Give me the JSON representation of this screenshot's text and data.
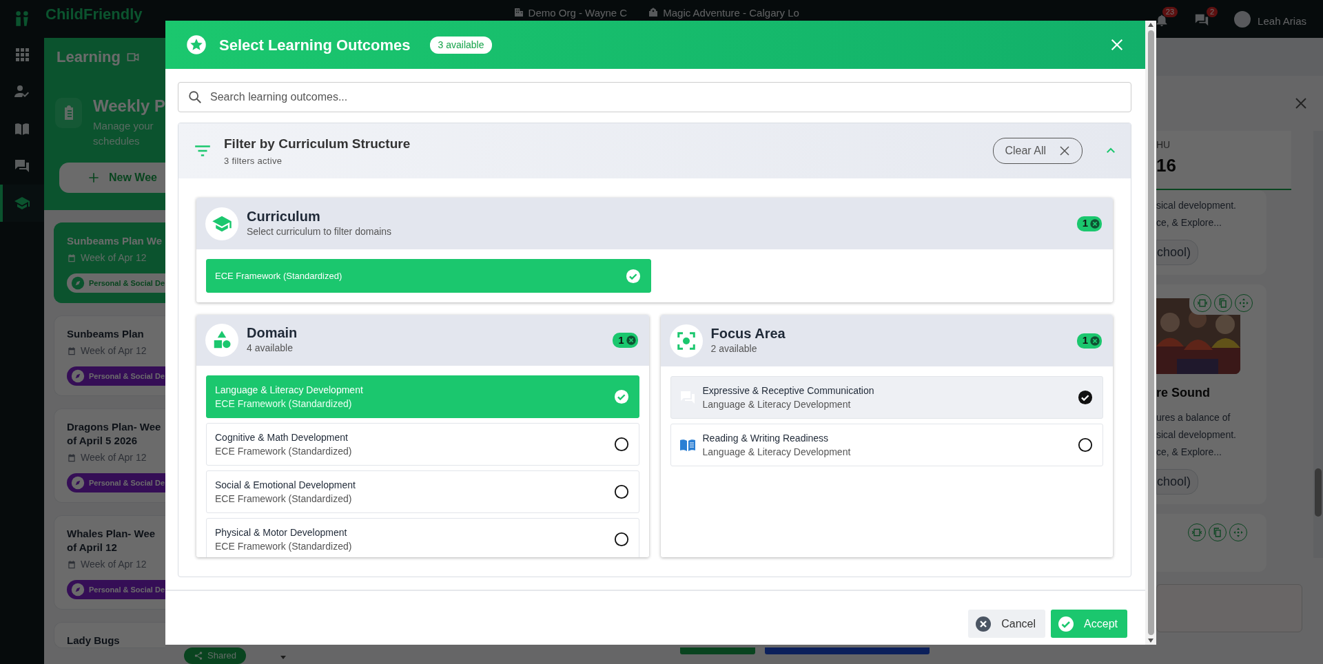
{
  "app": {
    "logo": "ChildFriendly",
    "org": "Demo Org - Wayne C",
    "location": "Magic Adventure - Calgary Lo",
    "notifications": "23",
    "messages": "2",
    "user": "Leah Arias"
  },
  "sidebar": {
    "items": [
      {
        "kind": "apps",
        "selected": false
      },
      {
        "kind": "attendance",
        "selected": false
      },
      {
        "kind": "book",
        "selected": false
      },
      {
        "kind": "chat",
        "selected": false
      },
      {
        "kind": "cap",
        "selected": true
      }
    ]
  },
  "page": {
    "title": "Learning",
    "heading": "Weekly P",
    "subtitle_lines": [
      "Manage your",
      "schedules"
    ],
    "new_button": "New Wee"
  },
  "plans": [
    {
      "title_lines": [
        "Sunbeams Plan We"
      ],
      "week": "Week of Apr 12",
      "tag": "Personal & Social De",
      "selected": true
    },
    {
      "title_lines": [
        "Sunbeams Plan"
      ],
      "week": "Week of Apr 12",
      "tag": "Personal & Social De",
      "selected": false
    },
    {
      "title_lines": [
        "Dragons Plan- Wee",
        "of April 5 2026"
      ],
      "week": "Week of Apr 12",
      "tag": "Personal & Social De",
      "selected": false
    },
    {
      "title_lines": [
        "Whales Plan- Wee",
        "of April 12"
      ],
      "week": "Week of Apr 12",
      "tag": "Personal & Social De",
      "selected": false
    },
    {
      "title_lines": [
        "Lady Bugs"
      ]
    }
  ],
  "shared_badge": "Shared",
  "day_column": {
    "day": "HU",
    "date": "16"
  },
  "activities": [
    {
      "lines": [
        "sical development.",
        "ce, & Explore..."
      ],
      "tag": "chool)"
    },
    {
      "kind": "picture",
      "title": "re Sound",
      "lines": [
        "ures a balance of",
        "sical development.",
        "ce, & Explore..."
      ],
      "tag": "chool)"
    }
  ],
  "modal": {
    "title": "Select Learning Outcomes",
    "count": "3 available",
    "search": {
      "placeholder": "Search learning outcomes..."
    },
    "filter": {
      "title": "Filter by Curriculum Structure",
      "subtitle": "3 filters active",
      "clear": "Clear All",
      "expanded": true
    },
    "sections": [
      {
        "kind": "curriculum",
        "title": "Curriculum",
        "subtitle": "Select curriculum to filter domains",
        "count": "1",
        "options": [
          {
            "label": "ECE Framework (Standardized)",
            "selected": true
          }
        ]
      },
      {
        "kind": "domain",
        "title": "Domain",
        "subtitle": "4 available",
        "count": "1",
        "options": [
          {
            "label": "Language & Literacy Development",
            "sub": "ECE Framework (Standardized)",
            "selected": true
          },
          {
            "label": "Cognitive & Math Development",
            "sub": "ECE Framework (Standardized)",
            "selected": false
          },
          {
            "label": "Social & Emotional Development",
            "sub": "ECE Framework (Standardized)",
            "selected": false
          },
          {
            "label": "Physical & Motor Development",
            "sub": "ECE Framework (Standardized)",
            "selected": false
          }
        ]
      },
      {
        "kind": "focus",
        "title": "Focus Area",
        "subtitle": "2 available",
        "count": "1",
        "options": [
          {
            "kind": "chat",
            "label": "Expressive & Receptive Communication",
            "sub": "Language & Literacy Development",
            "selected": true,
            "hovered": true
          },
          {
            "kind": "book",
            "label": "Reading & Writing Readiness",
            "sub": "Language & Literacy Development",
            "selected": false,
            "hovered": false
          }
        ]
      }
    ],
    "cancel": "Cancel",
    "accept": "Accept"
  }
}
